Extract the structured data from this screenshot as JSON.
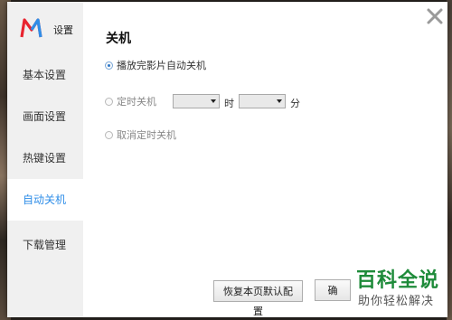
{
  "window": {
    "title": "设置"
  },
  "sidebar": {
    "items": [
      {
        "label": "基本设置",
        "active": false
      },
      {
        "label": "画面设置",
        "active": false
      },
      {
        "label": "热键设置",
        "active": false
      },
      {
        "label": "自动关机",
        "active": true
      },
      {
        "label": "下载管理",
        "active": false
      }
    ]
  },
  "content": {
    "section_title": "关机",
    "options": [
      {
        "label": "播放完影片自动关机",
        "checked": true
      },
      {
        "label": "定时关机",
        "checked": false
      },
      {
        "label": "取消定时关机",
        "checked": false
      }
    ],
    "hour_select": {
      "value": ""
    },
    "minute_select": {
      "value": ""
    },
    "hour_unit": "时",
    "minute_unit": "分"
  },
  "footer": {
    "restore_defaults_label": "恢复本页默认配置",
    "second_button_label": "确"
  },
  "watermark": {
    "title": "百科全说",
    "subtitle": "助你轻松解决"
  },
  "colors": {
    "accent": "#2f8ee8",
    "watermark_green": "#1e8b3a",
    "sidebar_bg": "#f0f0f0"
  },
  "icons": {
    "logo": "app-logo-icon",
    "close": "close-icon"
  }
}
